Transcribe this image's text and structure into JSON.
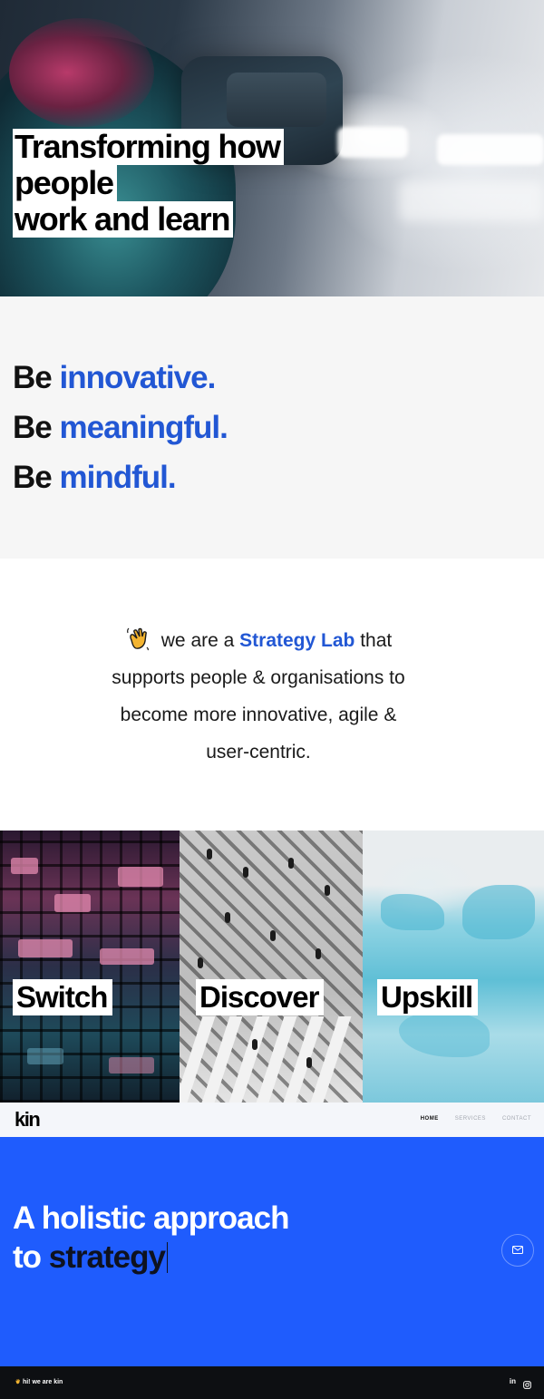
{
  "hero": {
    "title_lines": [
      "Transforming how",
      "people",
      "work and learn"
    ]
  },
  "motto": {
    "lines": [
      {
        "prefix": "Be",
        "accent": "innovative."
      },
      {
        "prefix": "Be",
        "accent": "meaningful."
      },
      {
        "prefix": "Be",
        "accent": "mindful."
      }
    ],
    "accent_color": "#2257d4"
  },
  "intro": {
    "wave_icon": "waving-hand-icon",
    "before": "we are a",
    "brand": "Strategy Lab",
    "after_first": "that",
    "line2": "supports people & organisations to",
    "line3": "become more innovative, agile &",
    "line4": "user-centric."
  },
  "tiles": [
    {
      "label": "Switch"
    },
    {
      "label": "Discover"
    },
    {
      "label": "Upskill"
    }
  ],
  "navbar": {
    "logo": "kin",
    "links": [
      "HOME",
      "SERVICES",
      "CONTACT"
    ],
    "active": "HOME"
  },
  "blue_section": {
    "line1": "A holistic approach",
    "line2_prefix": "to",
    "line2_highlight": "strategy",
    "background": "#1f5cfd",
    "mail_icon": "envelope-icon"
  },
  "footer": {
    "tagline": "hi! we are kin",
    "social_icons": [
      "linkedin-icon",
      "instagram-icon"
    ],
    "linkedin_text": "in"
  }
}
